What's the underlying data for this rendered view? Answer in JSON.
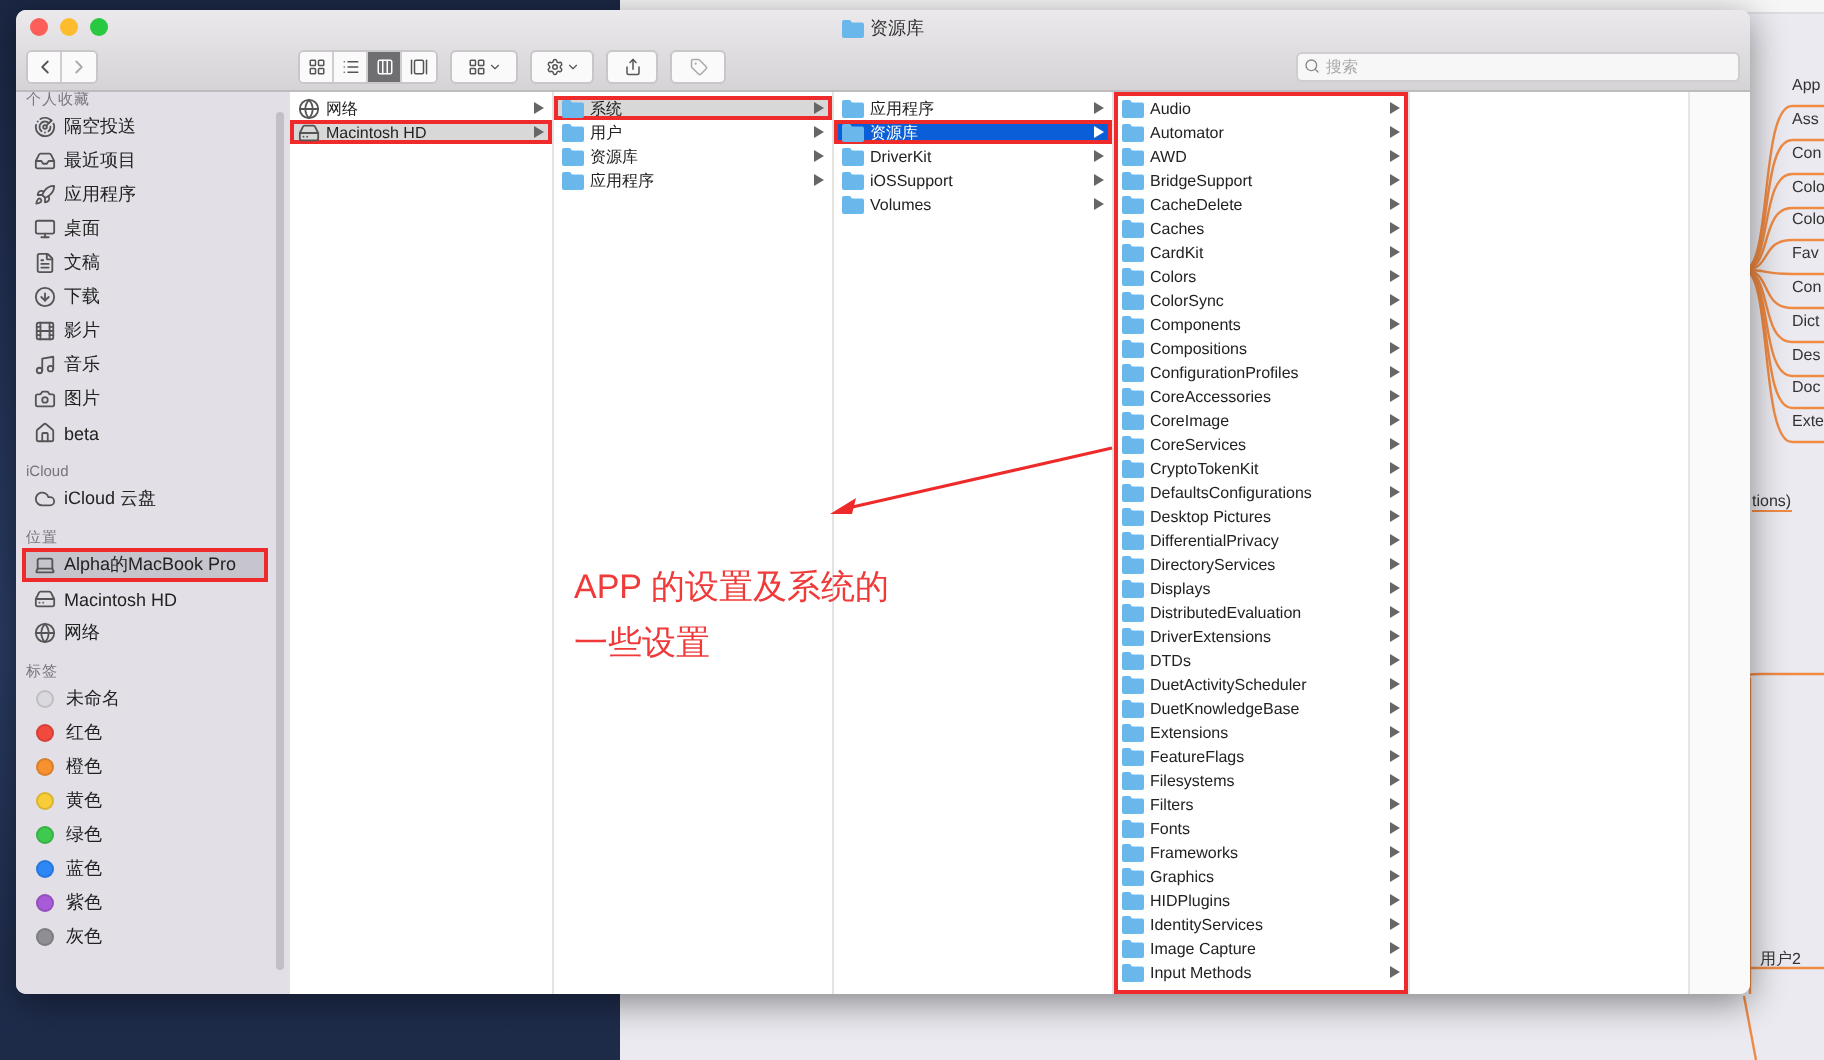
{
  "window": {
    "title": "资源库"
  },
  "toolbar": {
    "search": {
      "placeholder": "搜索"
    }
  },
  "sidebar": {
    "sections": [
      {
        "heading": "个人收藏",
        "items": [
          {
            "label": "隔空投送",
            "kind": "airdrop",
            "selected": false,
            "highlighted": false
          },
          {
            "label": "最近项目",
            "kind": "recents",
            "selected": false,
            "highlighted": false
          },
          {
            "label": "应用程序",
            "kind": "apps",
            "selected": false,
            "highlighted": false
          },
          {
            "label": "桌面",
            "kind": "desktop",
            "selected": false,
            "highlighted": false
          },
          {
            "label": "文稿",
            "kind": "documents",
            "selected": false,
            "highlighted": false
          },
          {
            "label": "下载",
            "kind": "downloads",
            "selected": false,
            "highlighted": false
          },
          {
            "label": "影片",
            "kind": "movies",
            "selected": false,
            "highlighted": false
          },
          {
            "label": "音乐",
            "kind": "music",
            "selected": false,
            "highlighted": false
          },
          {
            "label": "图片",
            "kind": "pictures",
            "selected": false,
            "highlighted": false
          },
          {
            "label": "beta",
            "kind": "home",
            "selected": false,
            "highlighted": false
          }
        ]
      },
      {
        "heading": "iCloud",
        "items": [
          {
            "label": "iCloud 云盘",
            "kind": "cloud",
            "selected": false,
            "highlighted": false
          }
        ]
      },
      {
        "heading": "位置",
        "items": [
          {
            "label": "Alpha的MacBook Pro",
            "kind": "computer",
            "selected": true,
            "highlighted": true
          },
          {
            "label": "Macintosh HD",
            "kind": "disk",
            "selected": false,
            "highlighted": false
          },
          {
            "label": "网络",
            "kind": "network",
            "selected": false,
            "highlighted": false
          }
        ]
      },
      {
        "heading": "标签",
        "items": [
          {
            "label": "未命名",
            "kind": "tag",
            "color": "#d9d9de",
            "selected": false,
            "highlighted": false
          },
          {
            "label": "红色",
            "kind": "tag",
            "color": "#f2493f",
            "selected": false,
            "highlighted": false
          },
          {
            "label": "橙色",
            "kind": "tag",
            "color": "#f7912f",
            "selected": false,
            "highlighted": false
          },
          {
            "label": "黄色",
            "kind": "tag",
            "color": "#f8cd37",
            "selected": false,
            "highlighted": false
          },
          {
            "label": "绿色",
            "kind": "tag",
            "color": "#3fc94e",
            "selected": false,
            "highlighted": false
          },
          {
            "label": "蓝色",
            "kind": "tag",
            "color": "#2d87f7",
            "selected": false,
            "highlighted": false
          },
          {
            "label": "紫色",
            "kind": "tag",
            "color": "#a85bd6",
            "selected": false,
            "highlighted": false
          },
          {
            "label": "灰色",
            "kind": "tag",
            "color": "#8e8e93",
            "selected": false,
            "highlighted": false
          }
        ]
      }
    ]
  },
  "columns": [
    {
      "highlighted": false,
      "items": [
        {
          "label": "网络",
          "kind": "network",
          "selected": false,
          "highlighted": false
        },
        {
          "label": "Macintosh HD",
          "kind": "disk",
          "selected": true,
          "focused": false,
          "highlighted": true
        }
      ]
    },
    {
      "highlighted": false,
      "items": [
        {
          "label": "系统",
          "kind": "folder",
          "selected": true,
          "focused": false,
          "highlighted": true
        },
        {
          "label": "用户",
          "kind": "folder",
          "selected": false,
          "highlighted": false
        },
        {
          "label": "资源库",
          "kind": "folder",
          "selected": false,
          "highlighted": false
        },
        {
          "label": "应用程序",
          "kind": "folder",
          "selected": false,
          "highlighted": false
        }
      ]
    },
    {
      "highlighted": false,
      "items": [
        {
          "label": "应用程序",
          "kind": "folder",
          "selected": false,
          "highlighted": false
        },
        {
          "label": "资源库",
          "kind": "folder",
          "selected": true,
          "focused": true,
          "highlighted": true
        },
        {
          "label": "DriverKit",
          "kind": "folder",
          "selected": false,
          "highlighted": false
        },
        {
          "label": "iOSSupport",
          "kind": "folder",
          "selected": false,
          "highlighted": false
        },
        {
          "label": "Volumes",
          "kind": "folder",
          "selected": false,
          "highlighted": false
        }
      ]
    },
    {
      "highlighted": true,
      "items": [
        {
          "label": "Audio",
          "kind": "folder",
          "selected": false,
          "highlighted": false
        },
        {
          "label": "Automator",
          "kind": "folder",
          "selected": false,
          "highlighted": false
        },
        {
          "label": "AWD",
          "kind": "folder",
          "selected": false,
          "highlighted": false
        },
        {
          "label": "BridgeSupport",
          "kind": "folder",
          "selected": false,
          "highlighted": false
        },
        {
          "label": "CacheDelete",
          "kind": "folder",
          "selected": false,
          "highlighted": false
        },
        {
          "label": "Caches",
          "kind": "folder",
          "selected": false,
          "highlighted": false
        },
        {
          "label": "CardKit",
          "kind": "folder",
          "selected": false,
          "highlighted": false
        },
        {
          "label": "Colors",
          "kind": "folder",
          "selected": false,
          "highlighted": false
        },
        {
          "label": "ColorSync",
          "kind": "folder",
          "selected": false,
          "highlighted": false
        },
        {
          "label": "Components",
          "kind": "folder",
          "selected": false,
          "highlighted": false
        },
        {
          "label": "Compositions",
          "kind": "folder",
          "selected": false,
          "highlighted": false
        },
        {
          "label": "ConfigurationProfiles",
          "kind": "folder",
          "selected": false,
          "highlighted": false
        },
        {
          "label": "CoreAccessories",
          "kind": "folder",
          "selected": false,
          "highlighted": false
        },
        {
          "label": "CoreImage",
          "kind": "folder",
          "selected": false,
          "highlighted": false
        },
        {
          "label": "CoreServices",
          "kind": "folder",
          "selected": false,
          "highlighted": false
        },
        {
          "label": "CryptoTokenKit",
          "kind": "folder",
          "selected": false,
          "highlighted": false
        },
        {
          "label": "DefaultsConfigurations",
          "kind": "folder",
          "selected": false,
          "highlighted": false
        },
        {
          "label": "Desktop Pictures",
          "kind": "folder",
          "selected": false,
          "highlighted": false
        },
        {
          "label": "DifferentialPrivacy",
          "kind": "folder",
          "selected": false,
          "highlighted": false
        },
        {
          "label": "DirectoryServices",
          "kind": "folder",
          "selected": false,
          "highlighted": false
        },
        {
          "label": "Displays",
          "kind": "folder",
          "selected": false,
          "highlighted": false
        },
        {
          "label": "DistributedEvaluation",
          "kind": "folder",
          "selected": false,
          "highlighted": false
        },
        {
          "label": "DriverExtensions",
          "kind": "folder",
          "selected": false,
          "highlighted": false
        },
        {
          "label": "DTDs",
          "kind": "folder",
          "selected": false,
          "highlighted": false
        },
        {
          "label": "DuetActivityScheduler",
          "kind": "folder",
          "selected": false,
          "highlighted": false
        },
        {
          "label": "DuetKnowledgeBase",
          "kind": "folder",
          "selected": false,
          "highlighted": false
        },
        {
          "label": "Extensions",
          "kind": "folder",
          "selected": false,
          "highlighted": false
        },
        {
          "label": "FeatureFlags",
          "kind": "folder",
          "selected": false,
          "highlighted": false
        },
        {
          "label": "Filesystems",
          "kind": "folder",
          "selected": false,
          "highlighted": false
        },
        {
          "label": "Filters",
          "kind": "folder",
          "selected": false,
          "highlighted": false
        },
        {
          "label": "Fonts",
          "kind": "folder",
          "selected": false,
          "highlighted": false
        },
        {
          "label": "Frameworks",
          "kind": "folder",
          "selected": false,
          "highlighted": false
        },
        {
          "label": "Graphics",
          "kind": "folder",
          "selected": false,
          "highlighted": false
        },
        {
          "label": "HIDPlugins",
          "kind": "folder",
          "selected": false,
          "highlighted": false
        },
        {
          "label": "IdentityServices",
          "kind": "folder",
          "selected": false,
          "highlighted": false
        },
        {
          "label": "Image Capture",
          "kind": "folder",
          "selected": false,
          "highlighted": false
        },
        {
          "label": "Input Methods",
          "kind": "folder",
          "selected": false,
          "highlighted": false
        }
      ]
    }
  ],
  "annotation": {
    "lines": [
      "APP 的设置及系统的",
      "一些设置"
    ]
  },
  "mind_map": {
    "branches": [
      "App",
      "Ass",
      "Con",
      "Colo",
      "Colo",
      "Fav",
      "Con",
      "Dict",
      "Des",
      "Doc",
      "Exte"
    ],
    "side_label": "tions)",
    "bottom_label": "用户2"
  }
}
